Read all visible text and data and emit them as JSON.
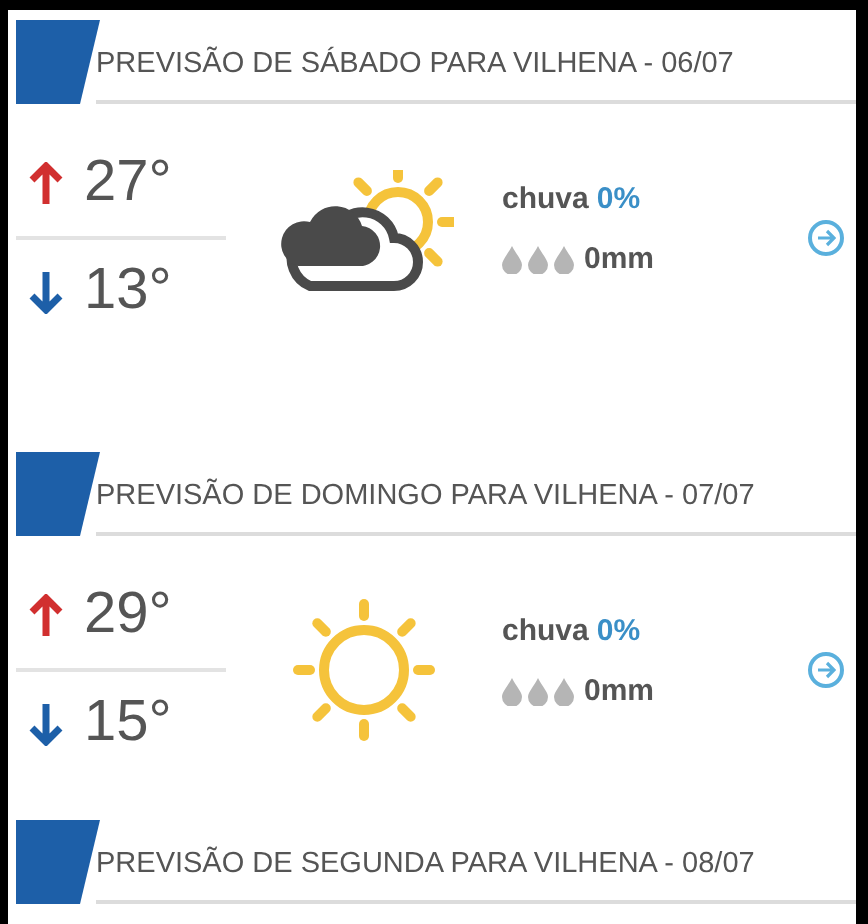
{
  "forecasts": [
    {
      "title": "PREVISÃO DE SÁBADO PARA VILHENA - 06/07",
      "high": "27°",
      "low": "13°",
      "kind": "partly-cloudy",
      "rain_label": "chuva",
      "rain_chance": "0%",
      "rain_amount": "0mm"
    },
    {
      "title": "PREVISÃO DE DOMINGO PARA VILHENA - 07/07",
      "high": "29°",
      "low": "15°",
      "kind": "sunny",
      "rain_label": "chuva",
      "rain_chance": "0%",
      "rain_amount": "0mm"
    },
    {
      "title": "PREVISÃO DE SEGUNDA PARA VILHENA - 08/07"
    }
  ]
}
